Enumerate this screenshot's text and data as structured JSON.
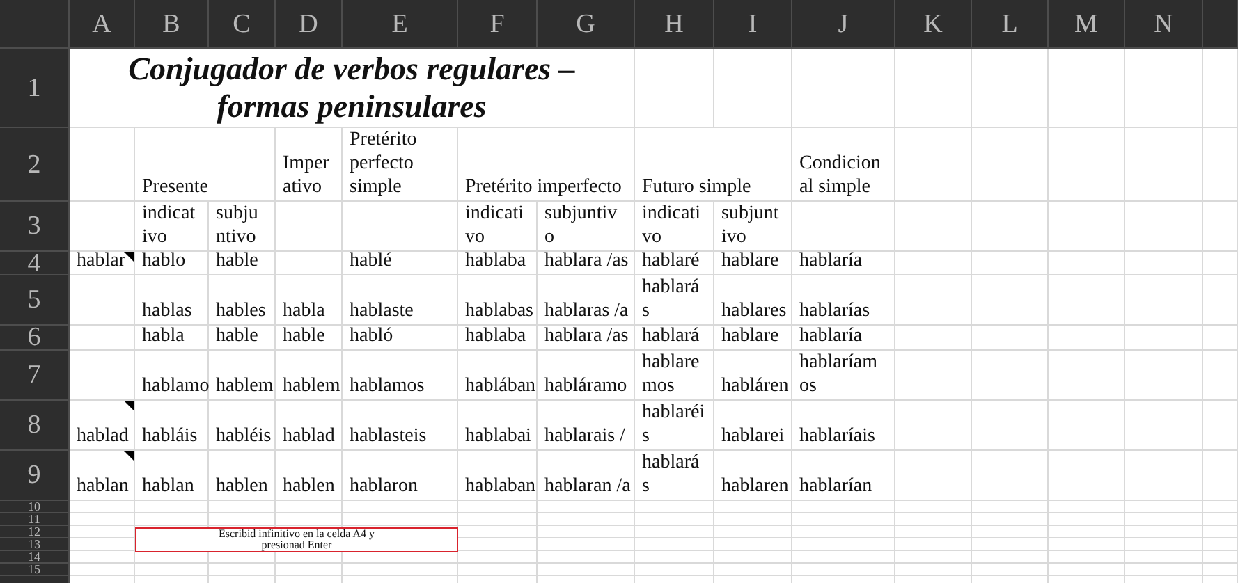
{
  "columns": [
    "A",
    "B",
    "C",
    "D",
    "E",
    "F",
    "G",
    "H",
    "I",
    "J",
    "K",
    "L",
    "M",
    "N"
  ],
  "rows": [
    {
      "number": "1",
      "cells": [
        {
          "kind": "title",
          "lines": [
            "Conjugador de verbos regulares –",
            "formas peninsulares"
          ]
        },
        {
          "kind": "merged"
        },
        {
          "kind": "merged"
        },
        {
          "kind": "merged"
        },
        {
          "kind": "merged"
        },
        {
          "kind": "merged"
        },
        {
          "kind": "merged"
        }
      ]
    },
    {
      "number": "2",
      "cells": [
        {
          "kind": "empty"
        },
        {
          "kind": "text",
          "lines": [
            "Presente"
          ]
        },
        {
          "kind": "merged"
        },
        {
          "kind": "text",
          "lines": [
            "Imper",
            "ativo"
          ]
        },
        {
          "kind": "text",
          "lines": [
            "Pretérito",
            "perfecto",
            "simple"
          ]
        },
        {
          "kind": "text",
          "lines": [
            "Pretérito imperfecto"
          ]
        },
        {
          "kind": "merged"
        },
        {
          "kind": "text",
          "lines": [
            "Futuro simple"
          ]
        },
        {
          "kind": "merged"
        },
        {
          "kind": "text",
          "lines": [
            "Condicion",
            "al simple"
          ]
        }
      ]
    },
    {
      "number": "3",
      "cells": [
        {
          "kind": "empty"
        },
        {
          "kind": "text",
          "lines": [
            "indicat",
            "ivo"
          ]
        },
        {
          "kind": "text",
          "lines": [
            "subju",
            "ntivo"
          ]
        },
        {
          "kind": "empty"
        },
        {
          "kind": "empty"
        },
        {
          "kind": "text",
          "lines": [
            "indicati",
            "vo"
          ]
        },
        {
          "kind": "text",
          "lines": [
            "subjuntiv",
            "o"
          ]
        },
        {
          "kind": "text",
          "lines": [
            "indicati",
            "vo"
          ]
        },
        {
          "kind": "text",
          "lines": [
            "subjunt",
            "ivo"
          ]
        }
      ]
    },
    {
      "number": "4",
      "cells": [
        {
          "kind": "text",
          "lines": [
            "hablar"
          ],
          "comment": true
        },
        {
          "kind": "text",
          "lines": [
            "hablo"
          ]
        },
        {
          "kind": "text",
          "lines": [
            "hable"
          ]
        },
        {
          "kind": "empty"
        },
        {
          "kind": "text",
          "lines": [
            "hablé"
          ]
        },
        {
          "kind": "text",
          "lines": [
            "hablaba"
          ]
        },
        {
          "kind": "text",
          "lines": [
            "hablara /as"
          ]
        },
        {
          "kind": "text",
          "lines": [
            "hablaré"
          ]
        },
        {
          "kind": "text",
          "lines": [
            "hablare"
          ]
        },
        {
          "kind": "text",
          "lines": [
            "hablaría"
          ]
        }
      ]
    },
    {
      "number": "5",
      "cells": [
        {
          "kind": "empty"
        },
        {
          "kind": "text",
          "lines": [
            "hablas"
          ]
        },
        {
          "kind": "text",
          "lines": [
            "hables"
          ]
        },
        {
          "kind": "text",
          "lines": [
            "habla"
          ]
        },
        {
          "kind": "text",
          "lines": [
            "hablaste"
          ]
        },
        {
          "kind": "text",
          "lines": [
            "hablabas"
          ]
        },
        {
          "kind": "text",
          "lines": [
            "hablaras /a"
          ]
        },
        {
          "kind": "text",
          "lines": [
            "hablará",
            "s"
          ]
        },
        {
          "kind": "text",
          "lines": [
            "hablares"
          ]
        },
        {
          "kind": "text",
          "lines": [
            "hablarías"
          ]
        }
      ]
    },
    {
      "number": "6",
      "cells": [
        {
          "kind": "empty"
        },
        {
          "kind": "text",
          "lines": [
            "habla"
          ]
        },
        {
          "kind": "text",
          "lines": [
            "hable"
          ]
        },
        {
          "kind": "text",
          "lines": [
            "hable"
          ]
        },
        {
          "kind": "text",
          "lines": [
            "habló"
          ]
        },
        {
          "kind": "text",
          "lines": [
            "hablaba"
          ]
        },
        {
          "kind": "text",
          "lines": [
            "hablara /as"
          ]
        },
        {
          "kind": "text",
          "lines": [
            "hablará"
          ]
        },
        {
          "kind": "text",
          "lines": [
            "hablare"
          ]
        },
        {
          "kind": "text",
          "lines": [
            "hablaría"
          ]
        }
      ]
    },
    {
      "number": "7",
      "cells": [
        {
          "kind": "empty"
        },
        {
          "kind": "text",
          "lines": [
            "hablamo"
          ]
        },
        {
          "kind": "text",
          "lines": [
            "hablem"
          ]
        },
        {
          "kind": "text",
          "lines": [
            "hablem"
          ]
        },
        {
          "kind": "text",
          "lines": [
            "hablamos"
          ]
        },
        {
          "kind": "text",
          "lines": [
            "hablában"
          ]
        },
        {
          "kind": "text",
          "lines": [
            "habláramo"
          ]
        },
        {
          "kind": "text",
          "lines": [
            "hablare",
            "mos"
          ]
        },
        {
          "kind": "text",
          "lines": [
            "habláren"
          ]
        },
        {
          "kind": "text",
          "lines": [
            "hablaríam",
            "os"
          ]
        }
      ]
    },
    {
      "number": "8",
      "cells": [
        {
          "kind": "text",
          "lines": [
            "hablad"
          ],
          "comment": true
        },
        {
          "kind": "text",
          "lines": [
            "habláis"
          ]
        },
        {
          "kind": "text",
          "lines": [
            "habléis"
          ]
        },
        {
          "kind": "text",
          "lines": [
            "hablad"
          ]
        },
        {
          "kind": "text",
          "lines": [
            "hablasteis"
          ]
        },
        {
          "kind": "text",
          "lines": [
            "hablabai"
          ]
        },
        {
          "kind": "text",
          "lines": [
            "hablarais /"
          ]
        },
        {
          "kind": "text",
          "lines": [
            "hablaréi",
            "s"
          ]
        },
        {
          "kind": "text",
          "lines": [
            "hablarei"
          ]
        },
        {
          "kind": "text",
          "lines": [
            "hablaríais"
          ]
        }
      ]
    },
    {
      "number": "9",
      "cells": [
        {
          "kind": "text",
          "lines": [
            "hablan"
          ],
          "comment": true
        },
        {
          "kind": "text",
          "lines": [
            "hablan"
          ]
        },
        {
          "kind": "text",
          "lines": [
            "hablen"
          ]
        },
        {
          "kind": "text",
          "lines": [
            "hablen"
          ]
        },
        {
          "kind": "text",
          "lines": [
            "hablaron"
          ]
        },
        {
          "kind": "text",
          "lines": [
            "hablaban"
          ]
        },
        {
          "kind": "text",
          "lines": [
            "hablaran /a"
          ]
        },
        {
          "kind": "text",
          "lines": [
            "hablará",
            "s"
          ]
        },
        {
          "kind": "text",
          "lines": [
            "hablaren"
          ]
        },
        {
          "kind": "text",
          "lines": [
            "hablarían"
          ]
        }
      ]
    },
    {
      "number": "10",
      "cells": []
    },
    {
      "number": "11",
      "cells": []
    },
    {
      "number": "12",
      "cells": []
    },
    {
      "number": "13",
      "cells": []
    },
    {
      "number": "14",
      "cells": []
    },
    {
      "number": "15",
      "cells": []
    }
  ],
  "text_box": {
    "lines": [
      "Escribid infinitivo en la celda A4 y",
      "presionad Enter"
    ]
  }
}
